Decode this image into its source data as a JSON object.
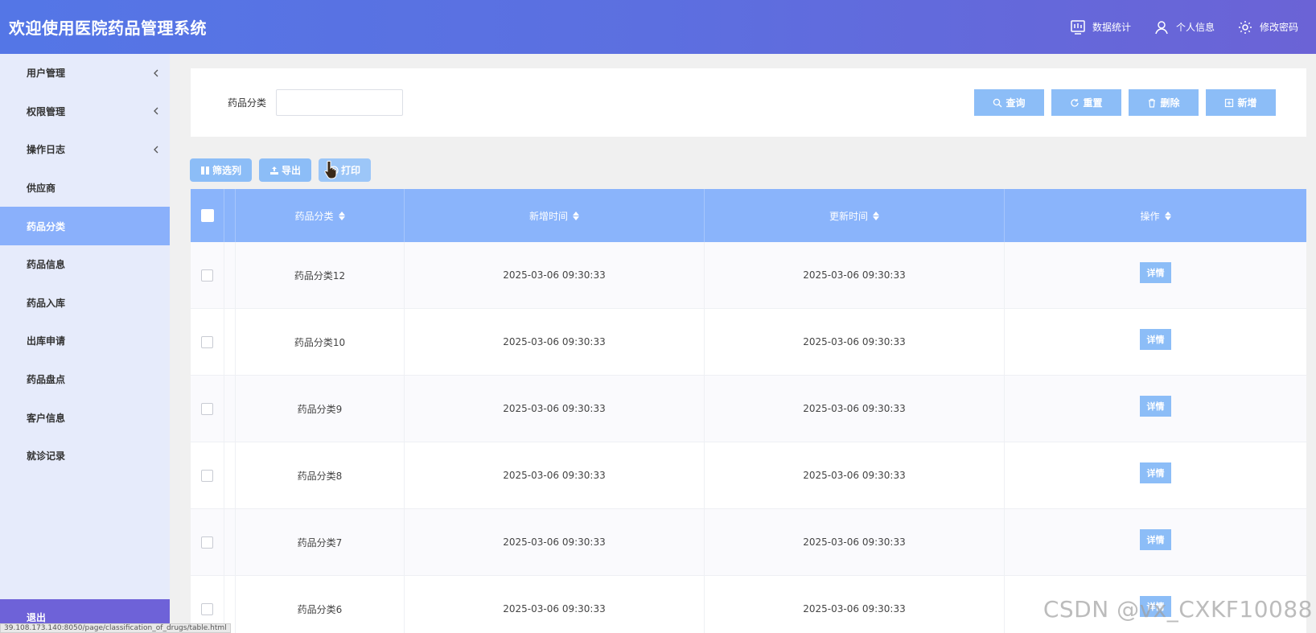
{
  "header": {
    "title": "欢迎使用医院药品管理系统",
    "links": [
      {
        "label": "数据统计",
        "icon": "chart-icon"
      },
      {
        "label": "个人信息",
        "icon": "user-icon"
      },
      {
        "label": "修改密码",
        "icon": "gear-icon"
      }
    ]
  },
  "sidebar": {
    "items": [
      {
        "label": "用户管理",
        "expandable": true
      },
      {
        "label": "权限管理",
        "expandable": true
      },
      {
        "label": "操作日志",
        "expandable": true
      },
      {
        "label": "供应商",
        "expandable": false
      },
      {
        "label": "药品分类",
        "expandable": false,
        "active": true
      },
      {
        "label": "药品信息",
        "expandable": false
      },
      {
        "label": "药品入库",
        "expandable": false
      },
      {
        "label": "出库申请",
        "expandable": false
      },
      {
        "label": "药品盘点",
        "expandable": false
      },
      {
        "label": "客户信息",
        "expandable": false
      },
      {
        "label": "就诊记录",
        "expandable": false
      }
    ],
    "logout_label": "退出"
  },
  "search": {
    "label": "药品分类",
    "value": "",
    "buttons": {
      "query": "查询",
      "reset": "重置",
      "delete": "删除",
      "add": "新增"
    }
  },
  "toolbar": {
    "filter_columns": "筛选列",
    "export": "导出",
    "print": "打印"
  },
  "table": {
    "columns": [
      "药品分类",
      "新增时间",
      "更新时间",
      "操作"
    ],
    "detail_label": "详情",
    "rows": [
      {
        "category": "药品分类12",
        "created": "2025-03-06 09:30:33",
        "updated": "2025-03-06 09:30:33"
      },
      {
        "category": "药品分类10",
        "created": "2025-03-06 09:30:33",
        "updated": "2025-03-06 09:30:33"
      },
      {
        "category": "药品分类9",
        "created": "2025-03-06 09:30:33",
        "updated": "2025-03-06 09:30:33"
      },
      {
        "category": "药品分类8",
        "created": "2025-03-06 09:30:33",
        "updated": "2025-03-06 09:30:33"
      },
      {
        "category": "药品分类7",
        "created": "2025-03-06 09:30:33",
        "updated": "2025-03-06 09:30:33"
      },
      {
        "category": "药品分类6",
        "created": "2025-03-06 09:30:33",
        "updated": "2025-03-06 09:30:33"
      }
    ]
  },
  "statusbar": {
    "url": "39.108.173.140:8050/page/classification_of_drugs/table.html"
  },
  "watermark": "CSDN @vx_CXKF10088",
  "colors": {
    "header_start": "#5476e6",
    "header_end": "#6b63d6",
    "sidebar_bg": "#e6ebfb",
    "sidebar_active": "#8ab0fb",
    "button": "#8cbdf7",
    "table_header": "#8ab4fb",
    "logout_bg": "#6e62d8"
  }
}
